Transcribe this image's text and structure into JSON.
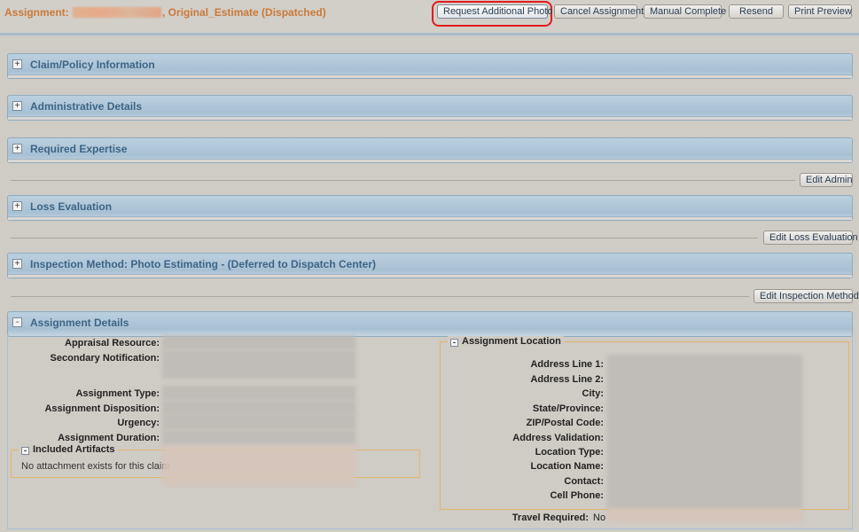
{
  "header": {
    "title_prefix": "Assignment: ",
    "title_suffix": ", Original_Estimate (Dispatched)",
    "buttons": {
      "request_photo": "Request Additional Photo",
      "cancel": "Cancel Assignment",
      "manual_complete": "Manual Complete",
      "resend": "Resend",
      "print_preview": "Print Preview"
    }
  },
  "sections": {
    "claim_policy": {
      "toggle": "+",
      "title": "Claim/Policy Information"
    },
    "admin": {
      "toggle": "+",
      "title": "Administrative Details"
    },
    "expertise": {
      "toggle": "+",
      "title": "Required Expertise"
    },
    "loss": {
      "toggle": "+",
      "title": "Loss Evaluation"
    },
    "inspection": {
      "toggle": "+",
      "title": "Inspection Method: Photo Estimating - (Deferred to Dispatch Center)"
    },
    "details": {
      "toggle": "-",
      "title": "Assignment Details"
    }
  },
  "edit_buttons": {
    "admin": "Edit Admin",
    "loss": "Edit Loss Evaluation",
    "inspection": "Edit Inspection Method"
  },
  "details": {
    "labels": {
      "appraisal_resource": "Appraisal Resource:",
      "secondary_notification": "Secondary Notification:",
      "assignment_type": "Assignment Type:",
      "assignment_disposition": "Assignment Disposition:",
      "urgency": "Urgency:",
      "assignment_duration": "Assignment Duration:"
    },
    "included_artifacts": {
      "legend": "Included Artifacts",
      "message": "No attachment exists for this claim"
    },
    "location": {
      "legend": "Assignment Location",
      "labels": {
        "address1": "Address Line 1:",
        "address2": "Address Line 2:",
        "city": "City:",
        "state": "State/Province:",
        "zip": "ZIP/Postal Code:",
        "validation": "Address Validation:",
        "location_type": "Location Type:",
        "location_name": "Location Name:",
        "contact": "Contact:",
        "cell_phone": "Cell Phone:"
      }
    },
    "travel_required": {
      "label": "Travel Required:",
      "value": "No"
    }
  }
}
